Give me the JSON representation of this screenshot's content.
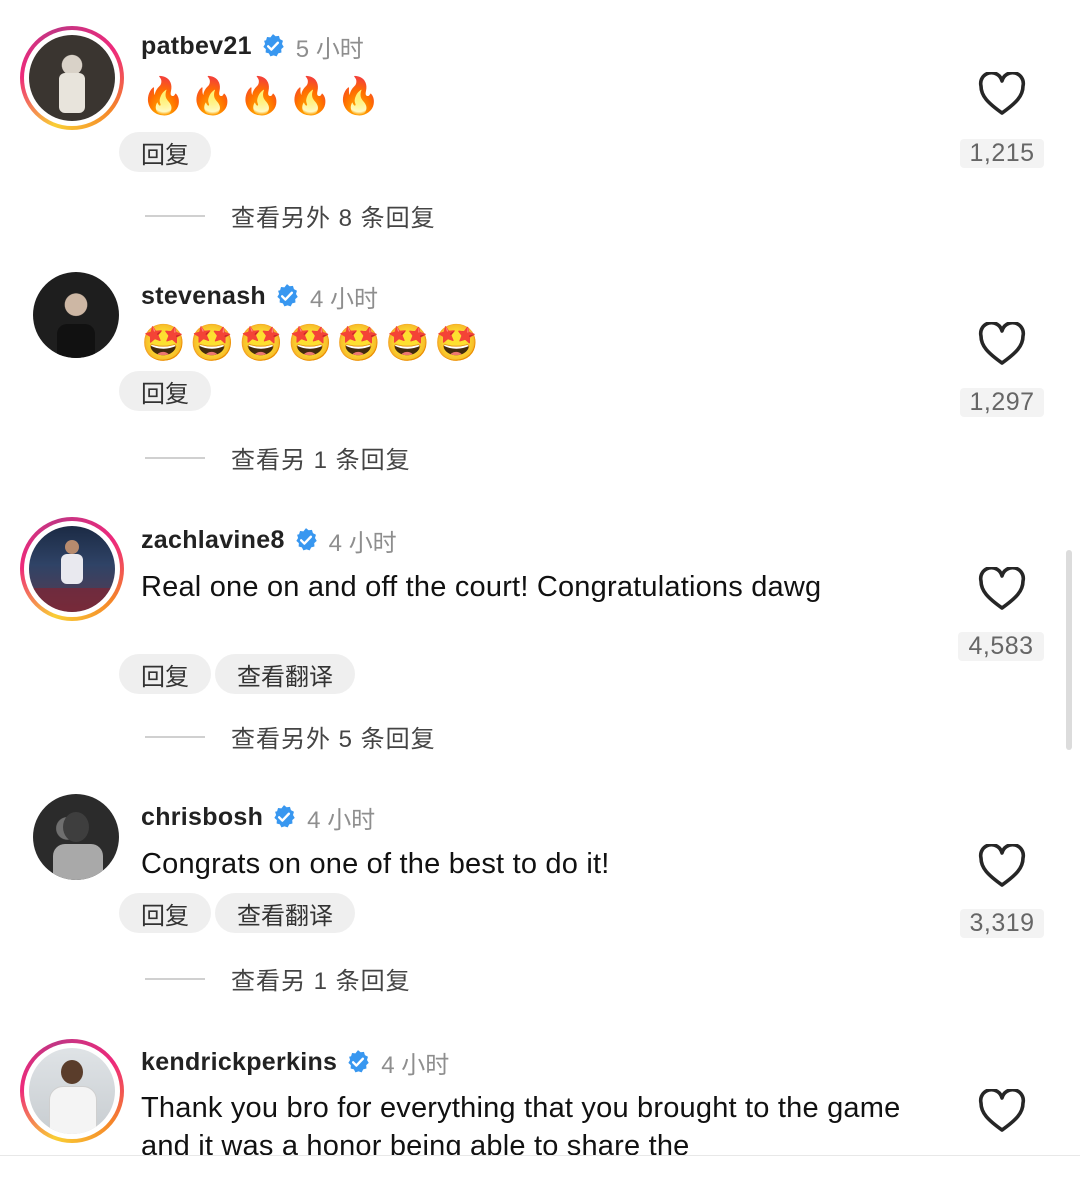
{
  "comments": [
    {
      "username": "patbev21",
      "time": "5 小时",
      "emojis": [
        "🔥",
        "🔥",
        "🔥",
        "🔥",
        "🔥"
      ],
      "reply_label": "回复",
      "likes": "1,215",
      "view_replies": "查看另外 8 条回复"
    },
    {
      "username": "stevenash",
      "time": "4 小时",
      "emojis": [
        "🤩",
        "🤩",
        "🤩",
        "🤩",
        "🤩",
        "🤩",
        "🤩"
      ],
      "reply_label": "回复",
      "likes": "1,297",
      "view_replies": "查看另 1 条回复"
    },
    {
      "username": "zachlavine8",
      "time": "4 小时",
      "text": "Real one on and off the court! Congratulations dawg",
      "reply_label": "回复",
      "translate_label": "查看翻译",
      "likes": "4,583",
      "view_replies": "查看另外 5 条回复"
    },
    {
      "username": "chrisbosh",
      "time": "4 小时",
      "text": "Congrats on one of the best to do it!",
      "reply_label": "回复",
      "translate_label": "查看翻译",
      "likes": "3,319",
      "view_replies": "查看另 1 条回复"
    },
    {
      "username": "kendrickperkins",
      "time": "4 小时",
      "text": "Thank you bro for everything that you brought to the game and it was a honor being able to share the"
    }
  ],
  "icons": {
    "verified": "verified-badge-icon",
    "like": "heart-outline-icon"
  },
  "colors": {
    "verified_blue": "#3897f0",
    "story_ring_start": "#f9ce34",
    "story_ring_end": "#ee2a7b"
  }
}
